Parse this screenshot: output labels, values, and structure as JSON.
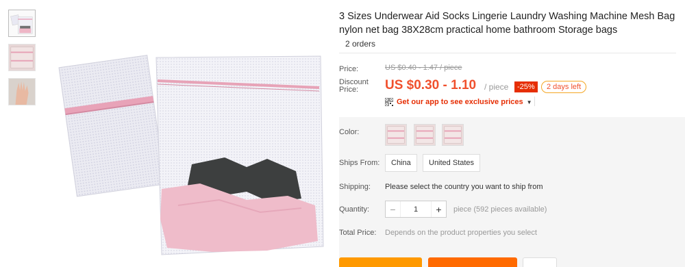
{
  "product": {
    "title": "3 Sizes Underwear Aid Socks Lingerie Laundry Washing Machine Mesh Bag nylon net bag 38X28cm practical home bathroom Storage bags",
    "orders": "2 orders"
  },
  "price": {
    "price_label": "Price:",
    "original": "US $0.40 - 1.47 / piece",
    "discount_label_1": "Discount",
    "discount_label_2": "Price:",
    "discount": "US $0.30 - 1.10",
    "per_piece": "/ piece",
    "discount_pct": "-25%",
    "days_left": "2 days left",
    "app_promo": "Get our app to see exclusive prices"
  },
  "options": {
    "color_label": "Color:",
    "ships_from_label": "Ships From:",
    "ships_from": [
      "China",
      "United States"
    ],
    "shipping_label": "Shipping:",
    "shipping_text": "Please select the country you want to ship from",
    "quantity_label": "Quantity:",
    "quantity_value": "1",
    "quantity_minus": "−",
    "quantity_plus": "+",
    "pieces_available": "piece (592 pieces available)",
    "total_label": "Total Price:",
    "total_text": "Depends on the product properties you select"
  },
  "colors": {
    "accent": "#f0502d",
    "badge": "#e62e04",
    "buy_now": "#ff9900",
    "add_to_cart": "#ff6a00"
  }
}
